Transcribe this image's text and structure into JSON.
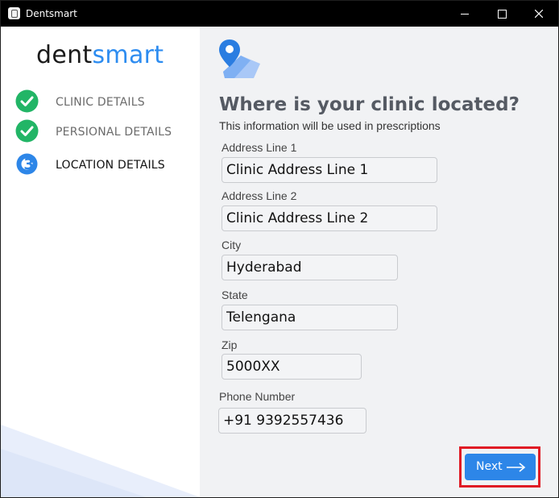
{
  "window": {
    "title": "Dentsmart"
  },
  "sidebar": {
    "logo": {
      "part1": "dent",
      "part2": "smart"
    },
    "steps": [
      {
        "label": "CLINIC DETAILS",
        "status": "done"
      },
      {
        "label": "PERSIONAL DETAILS",
        "status": "done"
      },
      {
        "label": "LOCATION DETAILS",
        "status": "active",
        "number": "3"
      }
    ]
  },
  "main": {
    "heading": "Where is your clinic located?",
    "subheading": "This information will be used in prescriptions",
    "fields": {
      "address1": {
        "label": "Address Line 1",
        "value": "Clinic Address Line 1"
      },
      "address2": {
        "label": "Address Line 2",
        "value": "Clinic Address Line 2"
      },
      "city": {
        "label": "City",
        "value": "Hyderabad"
      },
      "state": {
        "label": "State",
        "value": "Telengana"
      },
      "zip": {
        "label": "Zip",
        "value": "5000XX"
      },
      "phone": {
        "label": "Phone Number",
        "value": "+91 9392557436"
      }
    },
    "next_label": "Next"
  },
  "colors": {
    "accent": "#2d86e8",
    "check_green": "#22b566",
    "highlight_red": "#e01b24",
    "heading_gray": "#555a63"
  },
  "icons": [
    "app-icon",
    "minimize-icon",
    "maximize-icon",
    "close-icon",
    "check-icon",
    "step-number-icon",
    "map-pin-icon",
    "arrow-right-icon"
  ]
}
